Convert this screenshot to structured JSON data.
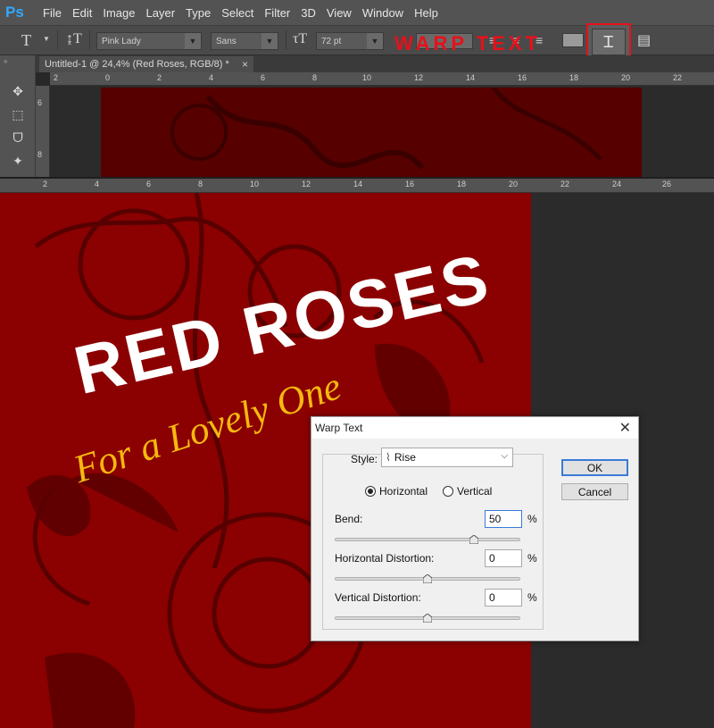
{
  "app": {
    "logo": "Ps"
  },
  "menu": [
    "File",
    "Edit",
    "Image",
    "Layer",
    "Type",
    "Select",
    "Filter",
    "3D",
    "View",
    "Window",
    "Help"
  ],
  "options_bar": {
    "font_family": "Pink Lady",
    "font_style": "Sans",
    "font_size": "72 pt",
    "callout": "WARP TEXT"
  },
  "document": {
    "tab_title": "Untitled-1 @ 24,4% (Red Roses, RGB/8) *",
    "close": "×"
  },
  "rulers": {
    "top_numbers": [
      "2",
      "0",
      "2",
      "4",
      "6",
      "8",
      "10",
      "12",
      "14",
      "16",
      "18",
      "20",
      "22"
    ],
    "left_numbers": [
      "6",
      "8"
    ],
    "main_numbers": [
      "2",
      "4",
      "6",
      "8",
      "10",
      "12",
      "14",
      "16",
      "18",
      "20",
      "22",
      "24",
      "26"
    ]
  },
  "canvas": {
    "title_text": "RED ROSES",
    "subtitle_text": "For a Lovely One"
  },
  "dialog": {
    "title": "Warp Text",
    "style_label": "Style:",
    "style_value": "Rise",
    "orientation": {
      "horizontal": "Horizontal",
      "vertical": "Vertical",
      "selected": "horizontal"
    },
    "bend": {
      "label": "Bend:",
      "value": "50",
      "unit": "%",
      "percent": 50
    },
    "h_distortion": {
      "label": "Horizontal Distortion:",
      "value": "0",
      "unit": "%",
      "percent": 0
    },
    "v_distortion": {
      "label": "Vertical Distortion:",
      "value": "0",
      "unit": "%",
      "percent": 0
    },
    "ok_label": "OK",
    "cancel_label": "Cancel"
  }
}
